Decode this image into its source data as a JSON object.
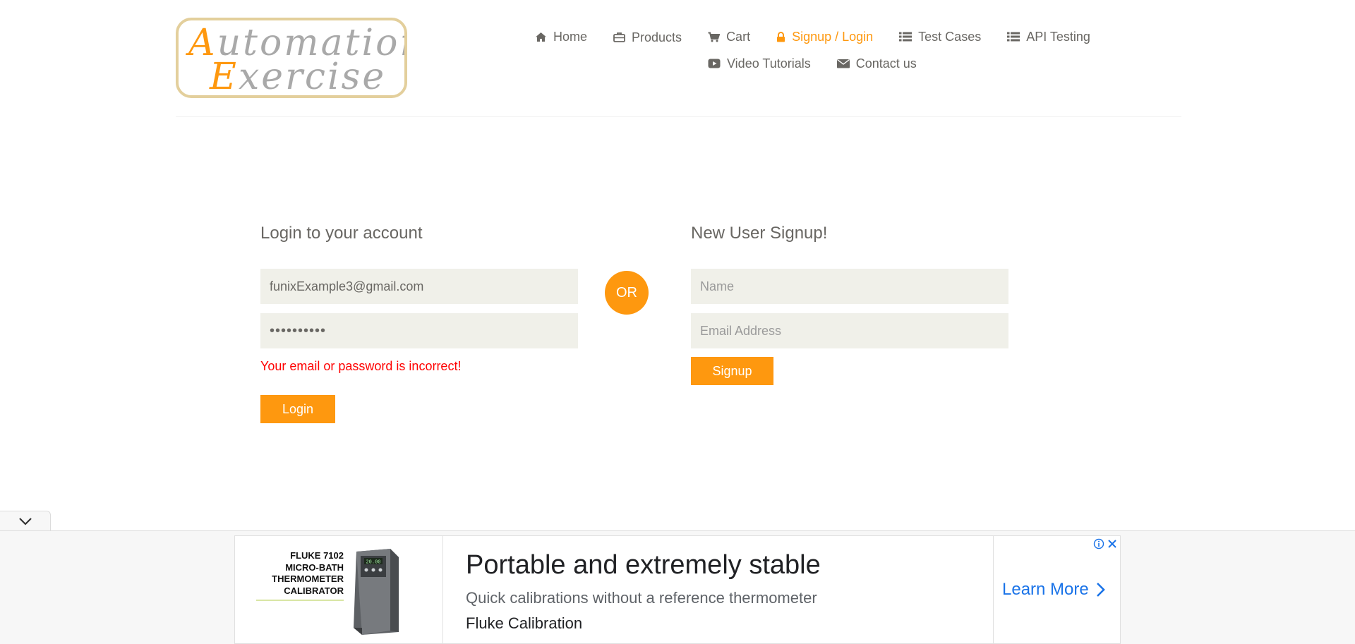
{
  "logo": {
    "line1_cap": "A",
    "line1_rest": "utomation",
    "line2_cap": "E",
    "line2_rest": "xercise"
  },
  "nav": {
    "items": [
      {
        "label": "Home",
        "icon": "home-icon"
      },
      {
        "label": "Products",
        "icon": "briefcase-icon"
      },
      {
        "label": "Cart",
        "icon": "cart-icon"
      },
      {
        "label": "Signup / Login",
        "icon": "lock-icon",
        "active": true
      },
      {
        "label": "Test Cases",
        "icon": "list-icon"
      },
      {
        "label": "API Testing",
        "icon": "list-icon"
      },
      {
        "label": "Video Tutorials",
        "icon": "play-icon"
      },
      {
        "label": "Contact us",
        "icon": "envelope-icon"
      }
    ]
  },
  "login": {
    "title": "Login to your account",
    "email_value": "funixExample3@gmail.com",
    "password_value": "••••••••••",
    "error": "Your email or password is incorrect!",
    "button": "Login"
  },
  "divider": {
    "label": "OR"
  },
  "signup": {
    "title": "New User Signup!",
    "name_placeholder": "Name",
    "email_placeholder": "Email Address",
    "button": "Signup"
  },
  "ad": {
    "product_label": "FLUKE 7102 MICRO-BATH THERMOMETER CALIBRATOR",
    "device_display": "20.00",
    "headline": "Portable and extremely stable",
    "description": "Quick calibrations without a reference thermometer",
    "brand": "Fluke Calibration",
    "cta": "Learn More"
  },
  "colors": {
    "accent": "#fe980f",
    "error": "#ff0000",
    "input_bg": "#f0f0e9",
    "text": "#696763",
    "link_blue": "#1a73e8"
  }
}
